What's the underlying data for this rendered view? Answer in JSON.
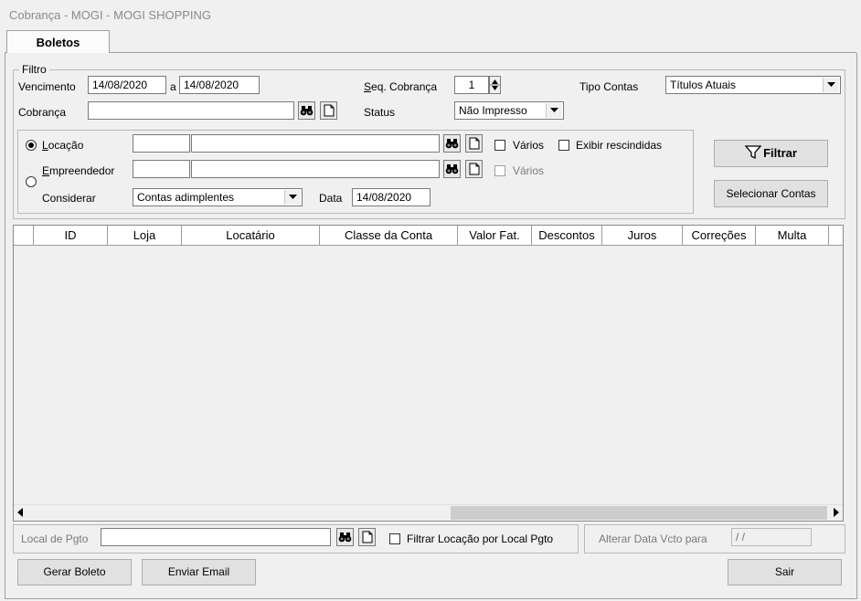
{
  "window": {
    "title": "Cobrança - MOGI - MOGI SHOPPING"
  },
  "tabs": [
    {
      "label": "Boletos"
    }
  ],
  "filtro": {
    "legend": "Filtro",
    "vencimento_label": "Vencimento",
    "vencimento_from": "14/08/2020",
    "a_label": "a",
    "vencimento_to": "14/08/2020",
    "seq_cobranca_label": "Seq. Cobrança",
    "seq_cobranca_value": "1",
    "tipo_contas_label": "Tipo Contas",
    "tipo_contas_value": "Títulos Atuais",
    "cobranca_label": "Cobrança",
    "cobranca_value": "",
    "status_label": "Status",
    "status_value": "Não Impresso",
    "locacao_label": "Locação",
    "empreendedor_label": "Empreendedor",
    "varios_label": "Vários",
    "exibir_rescindidas_label": "Exibir rescindidas",
    "varios2_label": "Vários",
    "considerar_label": "Considerar",
    "considerar_value": "Contas adimplentes",
    "data_label": "Data",
    "data_value": "14/08/2020",
    "filtrar_button": "Filtrar",
    "selecionar_button": "Selecionar Contas"
  },
  "grid": {
    "columns": [
      "ID",
      "Loja",
      "Locatário",
      "Classe da Conta",
      "Valor Fat.",
      "Descontos",
      "Juros",
      "Correções",
      "Multa"
    ]
  },
  "footer": {
    "local_pgto_label": "Local de Pgto",
    "local_pgto_value": "",
    "filtrar_locacao_label": "Filtrar Locação por Local Pgto",
    "alterar_data_label": "Alterar Data Vcto para",
    "alterar_data_value": " / /",
    "gerar_boleto": "Gerar Boleto",
    "enviar_email": "Enviar Email",
    "sair": "Sair"
  },
  "icons": {
    "search": "binoculars-icon",
    "new": "new-document-icon",
    "dropdown": "chevron-down-icon",
    "filter": "funnel-icon"
  }
}
